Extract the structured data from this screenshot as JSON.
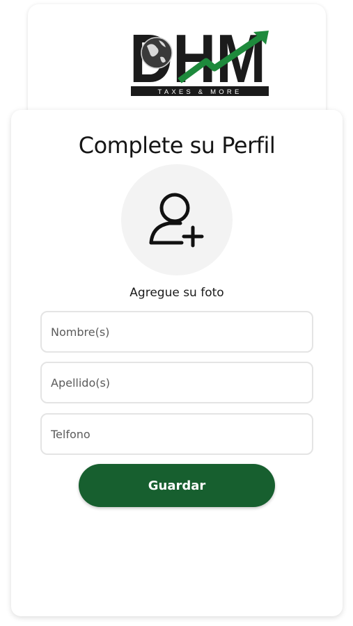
{
  "logo": {
    "letters": "DHM",
    "tagline": "TAXES & MORE",
    "colors": {
      "dark": "#1b1b1b",
      "accent": "#1e8a3c"
    }
  },
  "form": {
    "title": "Complete su Perfil",
    "avatar": {
      "icon": "add-user-icon",
      "label": "Agregue su foto"
    },
    "fields": {
      "nombre": {
        "placeholder": "Nombre(s)",
        "value": ""
      },
      "apellido": {
        "placeholder": "Apellido(s)",
        "value": ""
      },
      "telefono": {
        "placeholder": "Telfono",
        "value": ""
      }
    },
    "save_label": "Guardar"
  },
  "theme": {
    "primary": "#175f2f",
    "card_bg": "#ffffff",
    "avatar_bg": "#f3f3f3"
  }
}
